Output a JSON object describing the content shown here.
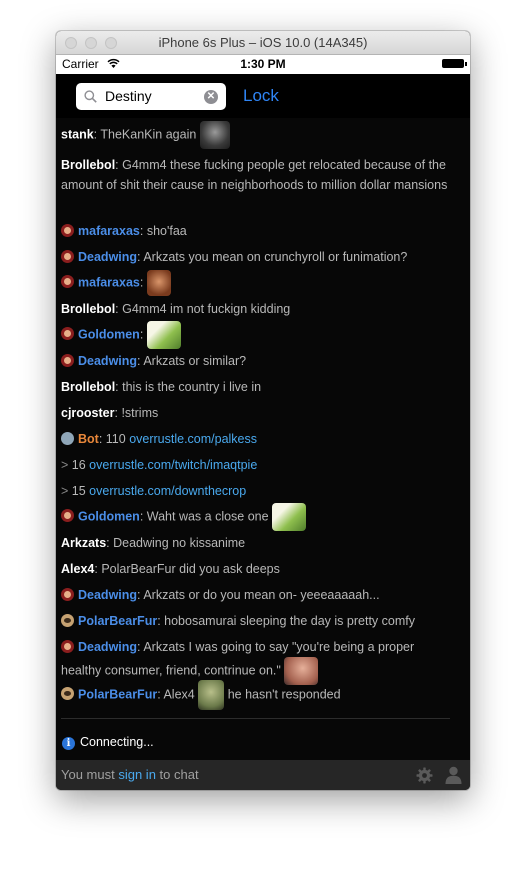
{
  "window": {
    "title": "iPhone 6s Plus – iOS 10.0 (14A345)"
  },
  "status_bar": {
    "carrier": "Carrier",
    "time": "1:30 PM",
    "wifi_icon": "wifi-icon",
    "battery_icon": "battery-icon"
  },
  "nav": {
    "search_value": "Destiny",
    "search_icon": "search-icon",
    "clear_icon": "clear-icon",
    "lock_label": "Lock"
  },
  "chat": {
    "messages": [
      {
        "user": "stank",
        "sep": ": ",
        "text": "TheKanKin again",
        "emote": "gorilla-emote"
      },
      {
        "user": "Brollebol",
        "sep": ": ",
        "text": "G4mm4 these fucking people get relocated because of the amount of shit their cause in neighborhoods to million dollar mansions"
      },
      {
        "user": "mafaraxas",
        "sep": ": ",
        "text": "sho'faa",
        "flair": "red-flair"
      },
      {
        "user": "Deadwing",
        "sep": ": ",
        "text": "Arkzats you mean on crunchyroll or funimation?",
        "flair": "red-flair"
      },
      {
        "user": "mafaraxas",
        "sep": ": ",
        "text": "",
        "flair": "red-flair",
        "emote": "face-emote"
      },
      {
        "user": "Brollebol",
        "sep": ": ",
        "text": "G4mm4 im not fuckign kidding"
      },
      {
        "user": "Goldomen",
        "sep": ": ",
        "text": "",
        "flair": "red-flair",
        "emote": "pepe-emote"
      },
      {
        "user": "Deadwing",
        "sep": ": ",
        "text": "Arkzats or similar?",
        "flair": "red-flair"
      },
      {
        "user": "Brollebol",
        "sep": ": ",
        "text": "this is the country i live in"
      },
      {
        "user": "cjrooster",
        "sep": ": ",
        "text": "!strims"
      },
      {
        "user": "Bot",
        "sep": ": ",
        "text": "110 ",
        "link": "overrustle.com/palkess",
        "flair": "bot-flair"
      },
      {
        "prefix": "> ",
        "text": "16 ",
        "link": "overrustle.com/twitch/imaqtpie"
      },
      {
        "prefix": "> ",
        "text": "15 ",
        "link": "overrustle.com/downthecrop"
      },
      {
        "user": "Goldomen",
        "sep": ": ",
        "text": "Waht was a close one",
        "flair": "red-flair",
        "emote": "pepe-emote"
      },
      {
        "user": "Arkzats",
        "sep": ": ",
        "text": "Deadwing no kissanime"
      },
      {
        "user": "Alex4",
        "sep": ": ",
        "text": "PolarBearFur did you ask deeps"
      },
      {
        "user": "Deadwing",
        "sep": ": ",
        "text": "Arkzats or do you mean on- yeeeaaaaah...",
        "flair": "red-flair"
      },
      {
        "user": "PolarBearFur",
        "sep": ": ",
        "text": "hobosamurai sleeping the day is pretty comfy",
        "flair": "tan-flair"
      },
      {
        "user": "Deadwing",
        "sep": ": ",
        "text": "Arkzats I was going to say \"you're being a proper healthy consumer, friend, contrinue on.\"",
        "flair": "red-flair",
        "emote": "cheeky-emote"
      },
      {
        "user": "PolarBearFur",
        "sep": ": ",
        "text": "Alex4 ",
        "text2": " he hasn't responded",
        "flair": "tan-flair",
        "emote": "zombie-emote"
      }
    ],
    "connecting": "Connecting...",
    "info_icon": "info-icon"
  },
  "footer": {
    "prefix": "You must ",
    "signin": "sign in",
    "suffix": " to chat",
    "gear_icon": "gear-icon",
    "profile_icon": "profile-icon"
  }
}
